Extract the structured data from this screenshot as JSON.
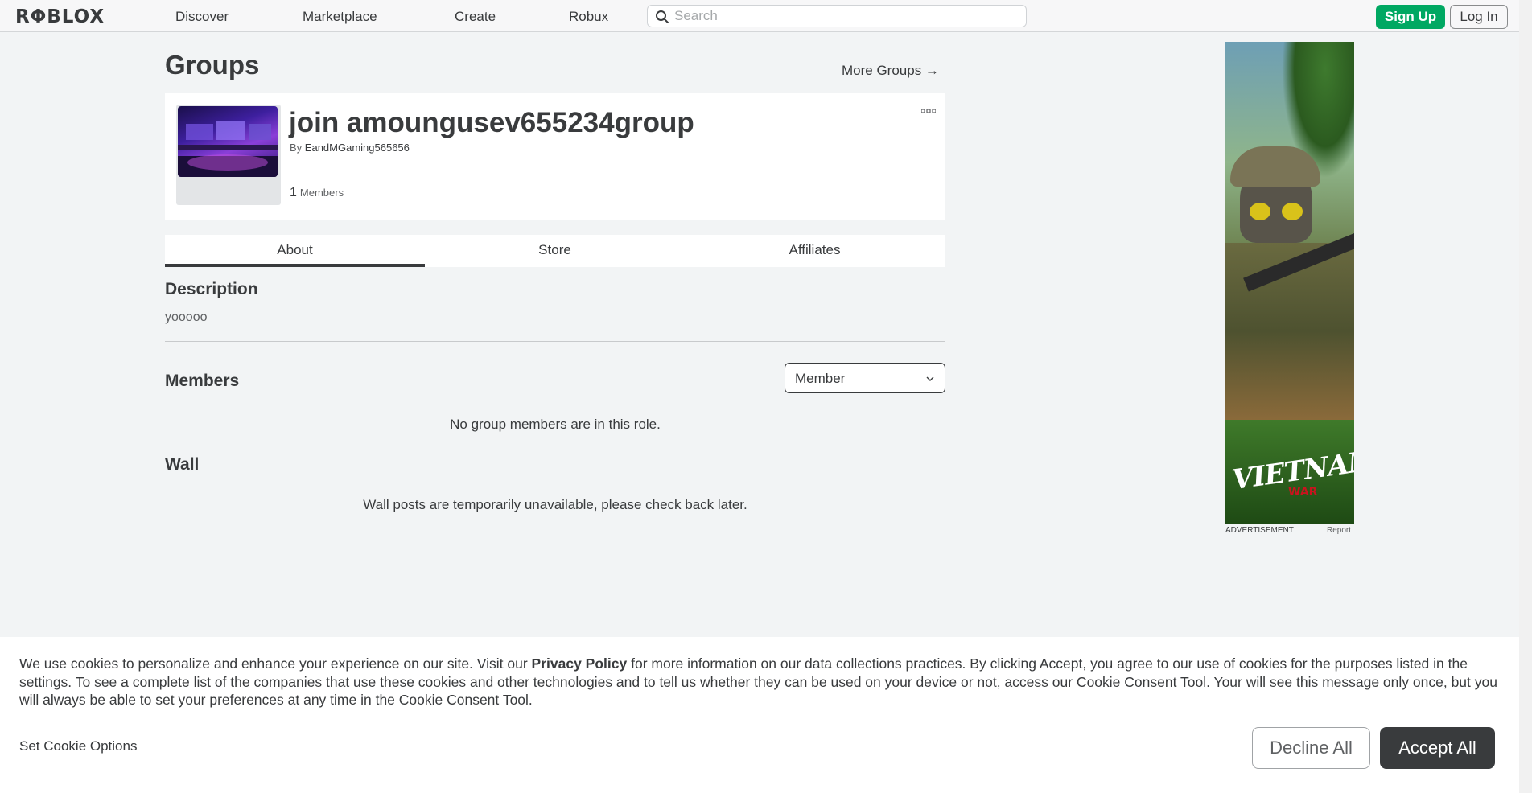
{
  "nav": {
    "logo": "RΦBLOX",
    "links": [
      "Discover",
      "Marketplace",
      "Create",
      "Robux"
    ],
    "search_placeholder": "Search",
    "signup_label": "Sign Up",
    "login_label": "Log In"
  },
  "page": {
    "title": "Groups",
    "more_groups": "More Groups →"
  },
  "group": {
    "name": "join amoungusev655234group",
    "by_prefix": "By",
    "owner": "EandMGaming565656",
    "members_num": "1",
    "members_label": "Members",
    "more_icon": "ellipsis-icon"
  },
  "tabs": [
    "About",
    "Store",
    "Affiliates"
  ],
  "about": {
    "description_heading": "Description",
    "description_text": "yooooo",
    "members_heading": "Members",
    "role_selected": "Member",
    "members_empty": "No group members are in this role.",
    "wall_heading": "Wall",
    "wall_msg": "Wall posts are temporarily unavailable, please check back later."
  },
  "ad": {
    "logo_text": "VIETNAM",
    "logo_sub": "WAR",
    "label": "ADVERTISEMENT",
    "report": "Report"
  },
  "cookie": {
    "text_1": "We use cookies to personalize and enhance your experience on our site. Visit our ",
    "privacy_link": "Privacy Policy",
    "text_2": " for more information on our data collections practices. By clicking Accept, you agree to our use of cookies for the purposes listed in the settings. To see a complete list of the companies that use these cookies and other technologies and to tell us whether they can be used on your device or not, access our Cookie Consent Tool. Your will see this message only once, but you will always be able to set your preferences at any time in the Cookie Consent Tool.",
    "options_label": "Set Cookie Options",
    "decline_label": "Decline All",
    "accept_label": "Accept All"
  }
}
